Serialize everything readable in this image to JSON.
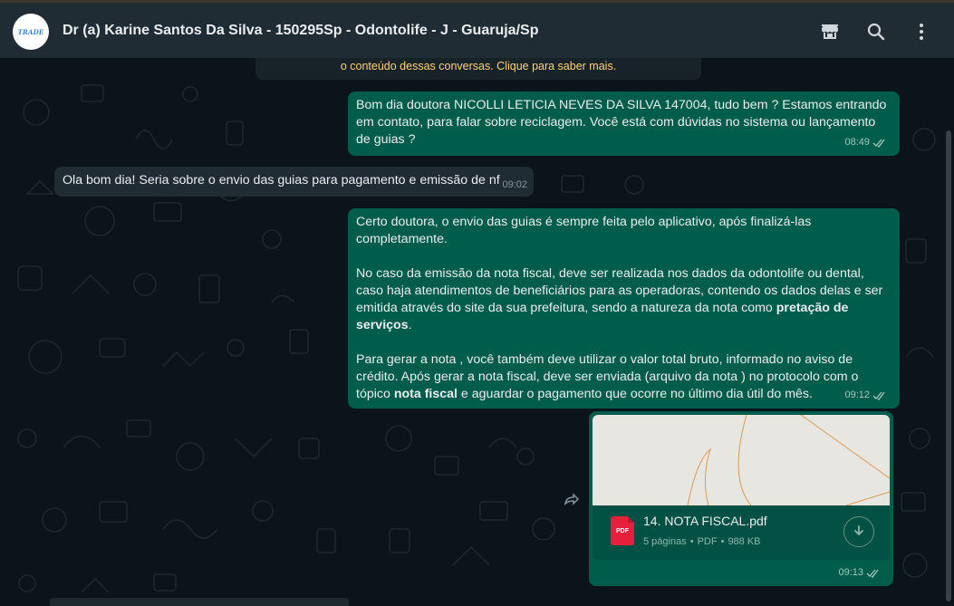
{
  "header": {
    "avatar_text": "TRADE",
    "title": "Dr (a) Karine Santos Da Silva - 150295Sp - Odontolife - J - Guaruja/Sp",
    "icons": [
      "store-icon",
      "search-icon",
      "more-options-icon"
    ]
  },
  "notice": {
    "text": "o conteúdo dessas conversas. Clique para saber mais."
  },
  "messages": [
    {
      "direction": "outgoing",
      "text": "Bom dia doutora NICOLLI LETICIA NEVES DA SILVA 147004, tudo bem ? Estamos entrando em contato, para falar sobre reciclagem. Você está com dúvidas no sistema ou lançamento de guias ?",
      "time": "08:49",
      "status": "read"
    },
    {
      "direction": "incoming",
      "text": "Ola bom dia! Seria sobre o envio das guias para pagamento e emissão de nf",
      "time": "09:02"
    },
    {
      "direction": "outgoing",
      "p1": "Certo doutora, o envio das guias é sempre feita pelo aplicativo, após finalizá-las completamente.",
      "p2_a": "No caso da emissão da nota fiscal, deve ser realizada nos dados da odontolife ou dental, caso haja atendimentos de beneficiários para as operadoras, contendo os dados delas e ser emitida através do site da sua prefeitura, sendo a natureza da nota como ",
      "p2_bold": "pretação de serviços",
      "p2_b": ".",
      "p3_a": "Para gerar a nota , você também deve utilizar o valor total bruto, informado no aviso de crédito. Após gerar a nota fiscal, deve ser enviada (arquivo da nota ) no protocolo com o tópico ",
      "p3_bold": "nota fiscal",
      "p3_b": " e aguardar o pagamento que ocorre no último dia útil do mês.",
      "time": "09:12",
      "status": "read"
    },
    {
      "direction": "outgoing",
      "type": "document",
      "file_type": "PDF",
      "file_name": "14. NOTA FISCAL.pdf",
      "pages": "5 páginas",
      "separator": "•",
      "size": "988 KB",
      "time": "09:13",
      "status": "read"
    }
  ],
  "colors": {
    "background": "#0b141a",
    "header": "#202c33",
    "outgoing_bubble": "#005c4b",
    "incoming_bubble": "#202c33",
    "notice_text": "#ffd279",
    "pdf_red": "#e6203a"
  }
}
